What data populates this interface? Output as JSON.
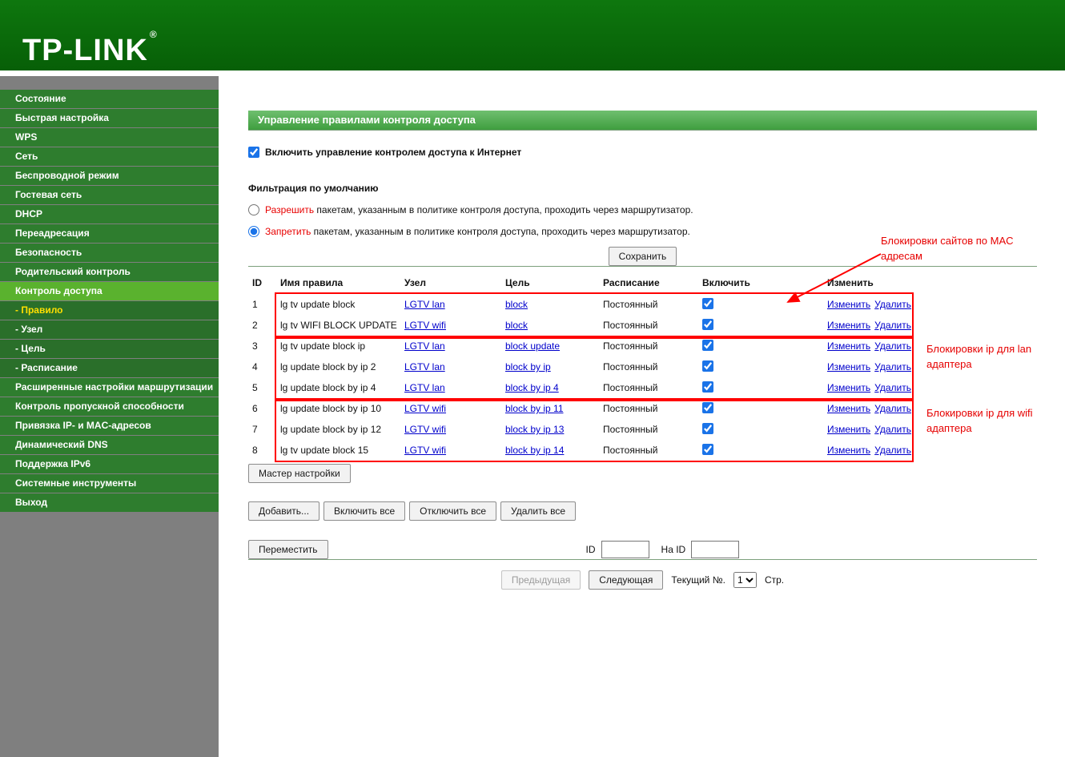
{
  "colors": {
    "brand_green": "#0a6d0a",
    "menu_green": "#2e7d2e",
    "selected_green": "#5ab22e",
    "title_bar_green": "#4ba64b",
    "link_blue": "#0000cc",
    "checkbox_blue": "#1a73e8",
    "annotation_red": "#ff0000",
    "sidebar_gray": "#7f7f7f"
  },
  "header": {
    "logo": "TP-LINK",
    "registered_mark": "®"
  },
  "sidebar": {
    "items": [
      {
        "label": "Состояние"
      },
      {
        "label": "Быстрая настройка"
      },
      {
        "label": "WPS"
      },
      {
        "label": "Сеть"
      },
      {
        "label": "Беспроводной режим"
      },
      {
        "label": "Гостевая сеть"
      },
      {
        "label": "DHCP"
      },
      {
        "label": "Переадресация"
      },
      {
        "label": "Безопасность"
      },
      {
        "label": "Родительский контроль"
      },
      {
        "label": "Контроль доступа",
        "selected": true
      },
      {
        "label": "- Правило",
        "sub": true,
        "active": true
      },
      {
        "label": "- Узел",
        "sub": true
      },
      {
        "label": "- Цель",
        "sub": true
      },
      {
        "label": "- Расписание",
        "sub": true
      },
      {
        "label": "Расширенные настройки маршрутизации"
      },
      {
        "label": "Контроль пропускной способности"
      },
      {
        "label": "Привязка IP- и MAC-адресов"
      },
      {
        "label": "Динамический DNS"
      },
      {
        "label": "Поддержка IPv6"
      },
      {
        "label": "Системные инструменты"
      },
      {
        "label": "Выход"
      }
    ]
  },
  "main": {
    "title": "Управление правилами контроля доступа",
    "enable": {
      "label": "Включить управление контролем доступа к Интернет",
      "checked": true
    },
    "filter": {
      "heading": "Фильтрация по умолчанию",
      "options": [
        {
          "word": "Разрешить",
          "rest": " пакетам, указанным в политике контроля доступа, проходить через маршрутизатор.",
          "selected": false
        },
        {
          "word": "Запретить",
          "rest": " пакетам, указанным в политике контроля доступа, проходить через маршрутизатор.",
          "selected": true
        }
      ]
    },
    "save_button": "Сохранить",
    "annotations": {
      "mac": "Блокировки сайтов по MAC адресам",
      "lan": "Блокировки ip для lan адаптера",
      "wifi": "Блокировки ip для wifi адаптера"
    },
    "table": {
      "headers": [
        "ID",
        "Имя правила",
        "Узел",
        "Цель",
        "Расписание",
        "Включить",
        "Изменить"
      ],
      "edit_label": "Изменить",
      "delete_label": "Удалить",
      "rows": [
        {
          "id": "1",
          "name": "lg tv update block",
          "host": "LGTV lan",
          "target": "block",
          "schedule": "Постоянный",
          "enabled": true
        },
        {
          "id": "2",
          "name": "lg tv WIFI BLOCK UPDATE",
          "host": "LGTV wifi",
          "target": "block",
          "schedule": "Постоянный",
          "enabled": true
        },
        {
          "id": "3",
          "name": "lg tv update block ip",
          "host": "LGTV lan",
          "target": "block update",
          "schedule": "Постоянный",
          "enabled": true
        },
        {
          "id": "4",
          "name": "lg update block by ip 2",
          "host": "LGTV lan",
          "target": "block by ip",
          "schedule": "Постоянный",
          "enabled": true
        },
        {
          "id": "5",
          "name": "lg update block by ip 4",
          "host": "LGTV lan",
          "target": "block by ip 4",
          "schedule": "Постоянный",
          "enabled": true
        },
        {
          "id": "6",
          "name": "lg update block by ip 10",
          "host": "LGTV wifi",
          "target": "block by ip 11",
          "schedule": "Постоянный",
          "enabled": true
        },
        {
          "id": "7",
          "name": "lg update block by ip 12",
          "host": "LGTV wifi",
          "target": "block by ip 13",
          "schedule": "Постоянный",
          "enabled": true
        },
        {
          "id": "8",
          "name": "lg tv update block 15",
          "host": "LGTV wifi",
          "target": "block by ip 14",
          "schedule": "Постоянный",
          "enabled": true
        }
      ]
    },
    "wizard_button": "Мастер настройки",
    "action_buttons": [
      "Добавить...",
      "Включить все",
      "Отключить все",
      "Удалить все"
    ],
    "move": {
      "button": "Переместить",
      "id_label": "ID",
      "to_label": "На ID",
      "id_value": "",
      "to_value": ""
    },
    "pagination": {
      "prev": "Предыдущая",
      "next": "Следующая",
      "current_label": "Текущий №.",
      "page": "1",
      "page_suffix": "Стр."
    }
  }
}
